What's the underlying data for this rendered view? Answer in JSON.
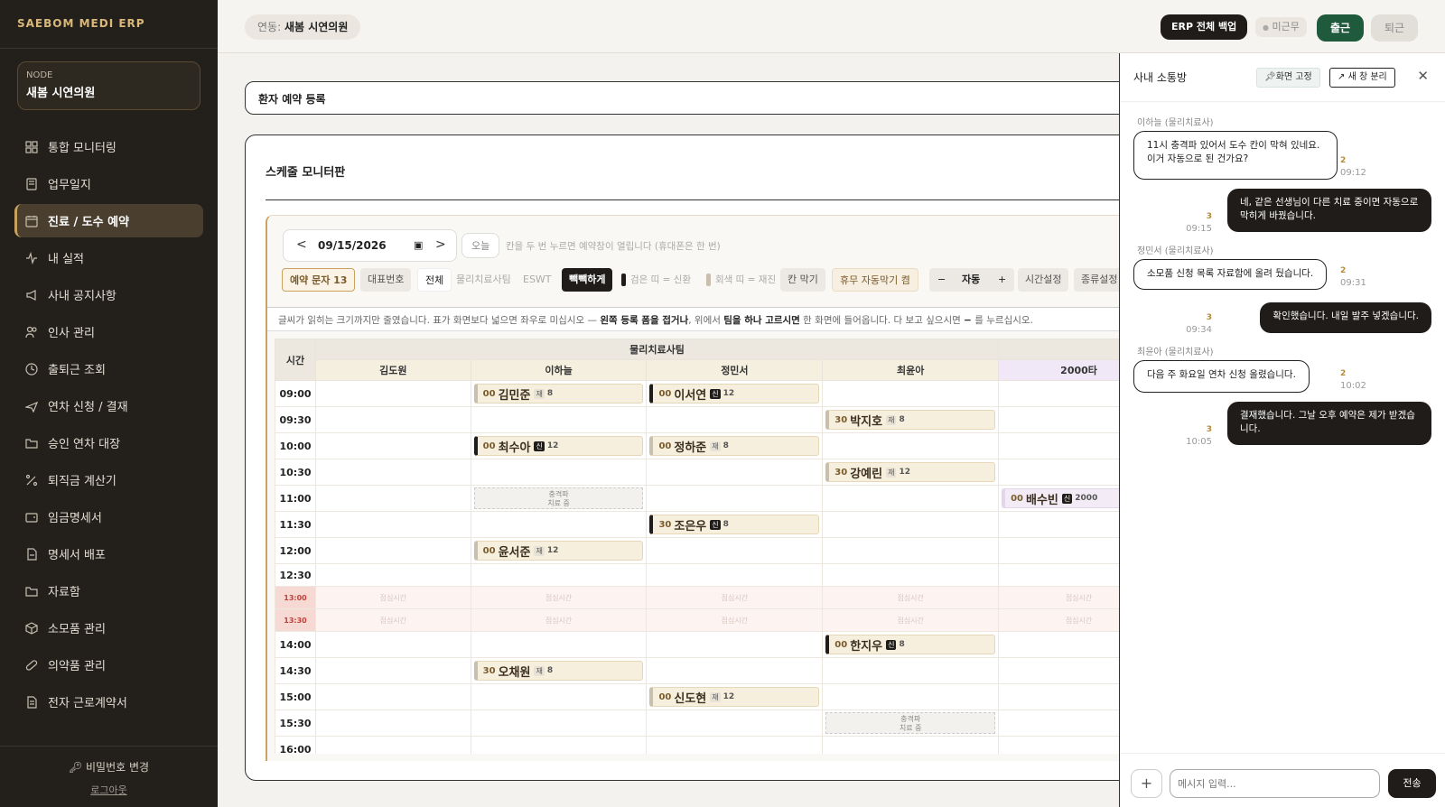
{
  "brand": "SAEBOM MEDI ERP",
  "node": {
    "label": "NODE",
    "name": "새봄 시연의원"
  },
  "nav": [
    {
      "label": "통합 모니터링",
      "icon": "dashboard-icon"
    },
    {
      "label": "업무일지",
      "icon": "journal-icon"
    },
    {
      "label": "진료 / 도수 예약",
      "icon": "calendar-icon",
      "active": true
    },
    {
      "label": "내 실적",
      "icon": "activity-icon"
    },
    {
      "label": "사내 공지사항",
      "icon": "megaphone-icon"
    },
    {
      "label": "인사 관리",
      "icon": "users-icon"
    },
    {
      "label": "출퇴근 조회",
      "icon": "clock-icon"
    },
    {
      "label": "연차 신청 / 결재",
      "icon": "plane-icon"
    },
    {
      "label": "승인 연차 대장",
      "icon": "folder-open-icon"
    },
    {
      "label": "퇴직금 계산기",
      "icon": "calculator-icon"
    },
    {
      "label": "임금명세서",
      "icon": "wallet-icon"
    },
    {
      "label": "명세서 배포",
      "icon": "send-document-icon"
    },
    {
      "label": "자료함",
      "icon": "folder-icon"
    },
    {
      "label": "소모품 관리",
      "icon": "box-icon"
    },
    {
      "label": "의약품 관리",
      "icon": "pill-icon"
    },
    {
      "label": "전자 근로계약서",
      "icon": "contract-icon"
    }
  ],
  "sidebar_bottom": {
    "password": "비밀번호 변경",
    "logout": "로그아웃"
  },
  "topbar": {
    "linked_label": "연동:",
    "linked_value": "새봄 시연의원",
    "backup": "ERP 전체 백업",
    "status": "미근무",
    "clock_in": "출근",
    "clock_out": "퇴근"
  },
  "patient_card": {
    "title": "환자 예약 등록"
  },
  "schedule": {
    "title": "스케줄 모니터판",
    "date": "09/15/2026",
    "today": "오늘",
    "hint": "칸을 두 번 누르면 예약창이 열립니다 (휴대폰은 한 번)",
    "toolbar": {
      "sms": "예약 문자 13",
      "main_number": "대표번호",
      "filter_all": "전체",
      "filter_pt": "물리치료사팀",
      "filter_eswt": "ESWT",
      "dense": "빽빽하게",
      "legend_new": "검은 띠 = 신환",
      "legend_re": "회색 띠 = 재진",
      "block": "칸 막기",
      "holiday": "휴무 자동막기 켬",
      "zoom_minus": "−",
      "zoom_value": "자동",
      "zoom_plus": "+",
      "time_setting": "시간설정",
      "type_setting": "종류설정"
    },
    "note": {
      "a": "글씨가 읽히는 크기까지만 줄였습니다. 표가 화면보다 넓으면 좌우로 미십시오 — ",
      "b": "왼쪽 등록 폼을 접거나",
      "c": ", 위에서 ",
      "d": "팀을 하나 고르시면",
      "e": " 한 화면에 들어옵니다. 다 보고 싶으시면 ",
      "f": "−",
      "g": " 를 누르십시오."
    },
    "time_header": "시간",
    "team_name": "물리치료사팀",
    "therapists": [
      "김도원",
      "이하늘",
      "정민서",
      "최윤아",
      "2000타"
    ],
    "lunch_label": "점심시간",
    "blocked_label": "충격파",
    "blocked_sub": "치료 중",
    "rows": [
      {
        "time": "09:00",
        "cells": [
          null,
          {
            "m": "00",
            "name": "김민준",
            "tag": "재",
            "dur": "8",
            "t": "re"
          },
          {
            "m": "00",
            "name": "이서연",
            "tag": "신",
            "dur": "12",
            "t": "new"
          },
          null,
          null
        ]
      },
      {
        "time": "09:30",
        "cells": [
          null,
          null,
          null,
          {
            "m": "30",
            "name": "박지호",
            "tag": "재",
            "dur": "8",
            "t": "re"
          },
          null
        ]
      },
      {
        "time": "10:00",
        "cells": [
          null,
          {
            "m": "00",
            "name": "최수아",
            "tag": "신",
            "dur": "12",
            "t": "new"
          },
          {
            "m": "00",
            "name": "정하준",
            "tag": "재",
            "dur": "8",
            "t": "re"
          },
          null,
          null
        ]
      },
      {
        "time": "10:30",
        "cells": [
          null,
          null,
          null,
          {
            "m": "30",
            "name": "강예린",
            "tag": "재",
            "dur": "12",
            "t": "re"
          },
          null
        ]
      },
      {
        "time": "11:00",
        "cells": [
          null,
          {
            "blocked": true
          },
          null,
          null,
          {
            "m": "00",
            "name": "배수빈",
            "tag": "신",
            "dur": "2000",
            "t": "new",
            "purple": true
          }
        ]
      },
      {
        "time": "11:30",
        "cells": [
          null,
          null,
          {
            "m": "30",
            "name": "조은우",
            "tag": "신",
            "dur": "8",
            "t": "new"
          },
          null,
          null
        ]
      },
      {
        "time": "12:00",
        "cells": [
          null,
          {
            "m": "00",
            "name": "윤서준",
            "tag": "재",
            "dur": "12",
            "t": "re"
          },
          null,
          null,
          null
        ]
      },
      {
        "time": "12:30",
        "cells": [
          null,
          null,
          null,
          null,
          null
        ],
        "short": true
      },
      {
        "time": "13:00",
        "lunch": true
      },
      {
        "time": "13:30",
        "lunch": true
      },
      {
        "time": "14:00",
        "cells": [
          null,
          null,
          null,
          {
            "m": "00",
            "name": "한지우",
            "tag": "신",
            "dur": "8",
            "t": "new"
          },
          null
        ]
      },
      {
        "time": "14:30",
        "cells": [
          null,
          {
            "m": "30",
            "name": "오채원",
            "tag": "재",
            "dur": "8",
            "t": "re"
          },
          null,
          null,
          null
        ]
      },
      {
        "time": "15:00",
        "cells": [
          null,
          null,
          {
            "m": "00",
            "name": "신도현",
            "tag": "재",
            "dur": "12",
            "t": "re"
          },
          null,
          null
        ]
      },
      {
        "time": "15:30",
        "cells": [
          null,
          null,
          null,
          {
            "blocked": true
          },
          null
        ]
      },
      {
        "time": "16:00",
        "cells": [
          null,
          null,
          null,
          null,
          null
        ]
      }
    ]
  },
  "chat": {
    "title": "사내 소통방",
    "pin": "화면 고정",
    "detach": "새 창 분리",
    "input_placeholder": "메시지 입력...",
    "send": "전송",
    "messages": [
      {
        "dir": "in",
        "sender": "이하늘 (물리치료사)",
        "text": "11시 충격파 있어서 도수 칸이 막혀 있네요. 이거 자동으로 된 건가요?",
        "read": "2",
        "time": "09:12"
      },
      {
        "dir": "out",
        "text": "네, 같은 선생님이 다른 치료 중이면 자동으로 막히게 바꿨습니다.",
        "read": "3",
        "time": "09:15"
      },
      {
        "dir": "in",
        "sender": "정민서 (물리치료사)",
        "text": "소모품 신청 목록 자료함에 올려 뒀습니다.",
        "read": "2",
        "time": "09:31"
      },
      {
        "dir": "out",
        "text": "확인했습니다. 내일 발주 넣겠습니다.",
        "read": "3",
        "time": "09:34"
      },
      {
        "dir": "in",
        "sender": "최윤아 (물리치료사)",
        "text": "다음 주 화요일 연차 신청 올렸습니다.",
        "read": "2",
        "time": "10:02"
      },
      {
        "dir": "out",
        "text": "결재했습니다. 그날 오후 예약은 제가 받겠습니다.",
        "read": "3",
        "time": "10:05"
      }
    ]
  }
}
